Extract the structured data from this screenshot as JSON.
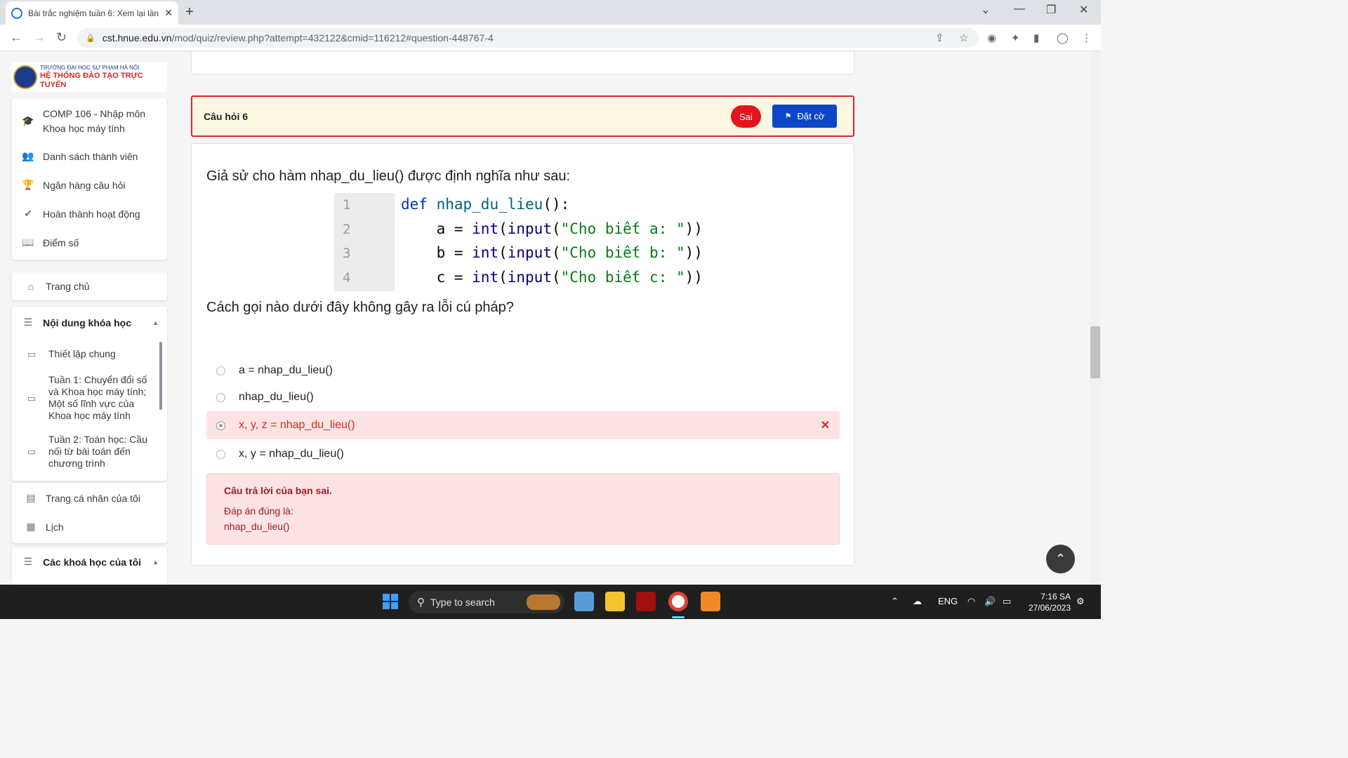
{
  "browser": {
    "tab_title": "Bài trắc nghiệm tuần 6: Xem lại lần",
    "url_host": "cst.hnue.edu.vn",
    "url_path": "/mod/quiz/review.php?attempt=432122&cmid=116212#question-448767-4"
  },
  "logo": {
    "line1": "TRƯỜNG ĐẠI HỌC SƯ PHẠM HÀ NỘI",
    "line2": "HỆ THỐNG ĐÀO TẠO TRỰC TUYẾN"
  },
  "course_menu": [
    {
      "icon": "graduation-cap-icon",
      "label": "COMP 106 - Nhập môn Khoa học máy tính"
    },
    {
      "icon": "users-icon",
      "label": "Danh sách thành viên"
    },
    {
      "icon": "trophy-icon",
      "label": "Ngân hàng câu hỏi"
    },
    {
      "icon": "check-icon",
      "label": "Hoàn thành hoạt động"
    },
    {
      "icon": "book-icon",
      "label": "Điểm số"
    }
  ],
  "nav": {
    "home": "Trang chủ",
    "content_section": "Nội dung khóa học",
    "content_items": [
      "Thiết lập chung",
      "Tuần 1: Chuyển đổi số và Khoa học máy tính; Một số lĩnh vực của Khoa học máy tính",
      "Tuần 2: Toán học: Cầu nối từ bài toán đến chương trình"
    ],
    "profile": "Trang cá nhân của tôi",
    "calendar": "Lịch",
    "my_courses": "Các khoá học của tôi"
  },
  "question": {
    "number_label": "Câu hỏi 6",
    "status": "Sai",
    "flag_label": "Đặt cờ",
    "prompt": "Giả sử cho hàm nhap_du_lieu() được định nghĩa như sau:",
    "code_lines": [
      "def nhap_du_lieu():",
      "    a = int(input(\"Cho biết a: \"))",
      "    b = int(input(\"Cho biết b: \"))",
      "    c = int(input(\"Cho biết c: \"))"
    ],
    "line_numbers": [
      "1",
      "2",
      "3",
      "4"
    ],
    "ask": "Cách gọi nào dưới đây không gây ra lỗi cú pháp?",
    "options": [
      {
        "text": "a = nhap_du_lieu()",
        "selected": false
      },
      {
        "text": "nhap_du_lieu()",
        "selected": false
      },
      {
        "text": "x, y, z = nhap_du_lieu()",
        "selected": true,
        "incorrect": true
      },
      {
        "text": "x, y = nhap_du_lieu()",
        "selected": false
      }
    ],
    "feedback_title": "Câu trả lời của bạn sai.",
    "correct_label": "Đáp án đúng là:",
    "correct_answer": "nhap_du_lieu()"
  },
  "taskbar": {
    "search_placeholder": "Type to search",
    "lang": "ENG",
    "time": "7:16 SA",
    "date": "27/06/2023"
  }
}
